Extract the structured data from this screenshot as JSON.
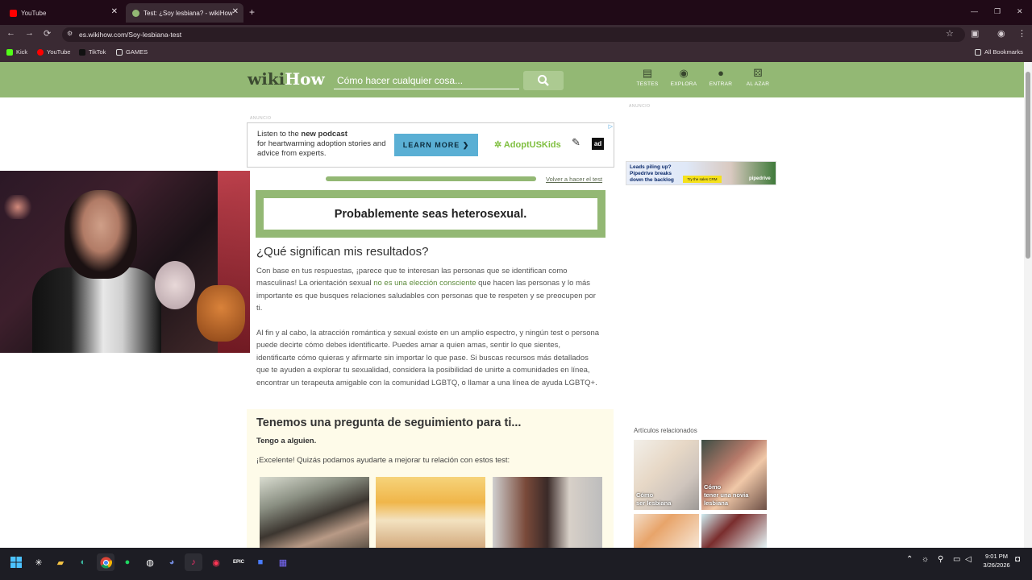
{
  "browser": {
    "tabs": [
      {
        "title": "YouTube",
        "close": "✕"
      },
      {
        "title": "Test: ¿Soy lesbiana? - wikiHow",
        "close": "✕"
      }
    ],
    "new_tab": "+",
    "window_controls": [
      "—",
      "❐",
      "✕"
    ],
    "nav": {
      "back": "←",
      "forward": "→",
      "reload": "⟳"
    },
    "url": "es.wikihow.com/Soy-lesbiana-test",
    "bookmarks": [
      "Kick",
      "YouTube",
      "TikTok",
      "GAMES"
    ],
    "all_bookmarks": "All Bookmarks"
  },
  "header": {
    "logo_part1": "wiki",
    "logo_part2": "How",
    "search_placeholder": "Cómo hacer cualquier cosa...",
    "nav": [
      {
        "label": "TESTES",
        "icon": "▤"
      },
      {
        "label": "EXPLORA",
        "icon": "◉"
      },
      {
        "label": "ENTRAR",
        "icon": "●"
      },
      {
        "label": "AL AZAR",
        "icon": "⚄"
      }
    ]
  },
  "ads": {
    "label_main": "ANUNCIO",
    "label_side": "ANUNCIO",
    "banner": {
      "text_pre": "Listen to the ",
      "text_bold": "new podcast",
      "text_post": "for heartwarming adoption stories and advice from experts.",
      "cta": "LEARN MORE",
      "cta_arrow": "❯",
      "brand": "✲ AdoptUSKids",
      "seal": "✎",
      "ad_council": "ad",
      "adchoices": "▷"
    },
    "side": {
      "line1": "Leads piling up?",
      "line2": "Pipedrive breaks",
      "line3": "down the backlog",
      "cta": "Try the sales CRM",
      "brand": "pipedrive"
    }
  },
  "quiz": {
    "progress_fraction": 1.0,
    "retake": "Volver a hacer el test",
    "result": "Probablemente seas heterosexual.",
    "meaning_heading": "¿Qué significan mis resultados?",
    "para1_a": "Con base en tus respuestas, ¡parece que te interesan las personas que se identifican como masculinas! La orientación sexual ",
    "para1_link": "no es una elección consciente",
    "para1_b": " que hacen las personas y lo más importante es que busques relaciones saludables con personas que te respeten y se preocupen por ti.",
    "para2": "Al fin y al cabo, la atracción romántica y sexual existe en un amplio espectro, y ningún test o persona puede decirte cómo debes identificarte. Puedes amar a quien amas, sentir lo que sientes, identificarte cómo quieras y afirmarte sin importar lo que pase. Si buscas recursos más detallados que te ayuden a explorar tu sexualidad, considera la posibilidad de unirte a comunidades en línea, encontrar un terapeuta amigable con la comunidad LGBTQ, o llamar a una línea de ayuda LGBTQ+.",
    "followup_heading": "Tenemos una pregunta de seguimiento para ti...",
    "followup_answer": "Tengo a alguien.",
    "followup_text": "¡Excelente! Quizás podamos ayudarte a mejorar tu relación con estos test:"
  },
  "related": {
    "title": "Artículos relacionados",
    "cards": [
      {
        "caption": "Cómo\nser lesbiana"
      },
      {
        "caption": "Cómo\ntener una novia\nlesbiana"
      }
    ]
  },
  "taskbar": {
    "time": "9:01 PM",
    "date": "3/26/2026"
  }
}
